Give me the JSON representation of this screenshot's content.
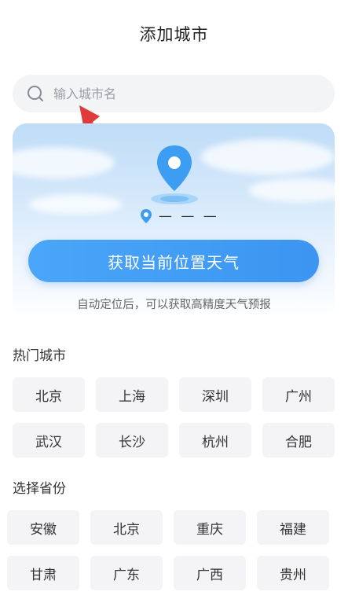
{
  "header": {
    "title": "添加城市"
  },
  "search": {
    "placeholder": "输入城市名"
  },
  "location_card": {
    "location_text": "— — —",
    "button_label": "获取当前位置天气",
    "hint": "自动定位后，可以获取高精度天气预报"
  },
  "hot_cities": {
    "title": "热门城市",
    "items": [
      "北京",
      "上海",
      "深圳",
      "广州",
      "武汉",
      "长沙",
      "杭州",
      "合肥"
    ]
  },
  "provinces": {
    "title": "选择省份",
    "items": [
      "安徽",
      "北京",
      "重庆",
      "福建",
      "甘肃",
      "广东",
      "广西",
      "贵州"
    ]
  },
  "colors": {
    "accent": "#3b95f1",
    "chip_bg": "#f4f4f6",
    "arrow": "#e03a3a"
  },
  "icons": [
    "search-icon",
    "location-pin-icon",
    "location-dot-icon"
  ]
}
